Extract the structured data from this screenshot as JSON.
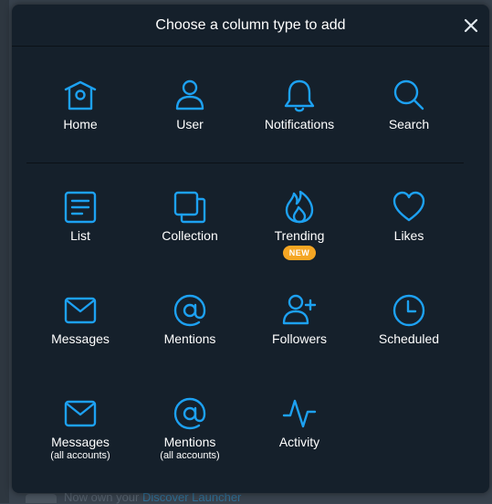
{
  "background": {
    "text_prefix": "Now own your",
    "text_link": "Discover Launcher",
    "colors": {
      "modal_bg": "#15202b",
      "accent": "#1da1f2",
      "badge": "#f5a623"
    }
  },
  "modal": {
    "title": "Choose a column type to add",
    "close_label": "×"
  },
  "columns": [
    {
      "id": "home",
      "label": "Home",
      "icon": "home-icon"
    },
    {
      "id": "user",
      "label": "User",
      "icon": "user-icon"
    },
    {
      "id": "notifications",
      "label": "Notifications",
      "icon": "bell-icon"
    },
    {
      "id": "search",
      "label": "Search",
      "icon": "search-icon"
    },
    {
      "id": "list",
      "label": "List",
      "icon": "list-icon"
    },
    {
      "id": "collection",
      "label": "Collection",
      "icon": "collection-icon"
    },
    {
      "id": "trending",
      "label": "Trending",
      "icon": "flame-icon",
      "badge": "NEW"
    },
    {
      "id": "likes",
      "label": "Likes",
      "icon": "heart-icon"
    },
    {
      "id": "messages",
      "label": "Messages",
      "icon": "envelope-icon"
    },
    {
      "id": "mentions",
      "label": "Mentions",
      "icon": "at-icon"
    },
    {
      "id": "followers",
      "label": "Followers",
      "icon": "user-plus-icon"
    },
    {
      "id": "scheduled",
      "label": "Scheduled",
      "icon": "clock-icon"
    },
    {
      "id": "messages_all",
      "label": "Messages",
      "sublabel": "(all accounts)",
      "icon": "envelope-icon"
    },
    {
      "id": "mentions_all",
      "label": "Mentions",
      "sublabel": "(all accounts)",
      "icon": "at-icon"
    },
    {
      "id": "activity",
      "label": "Activity",
      "icon": "activity-icon"
    }
  ]
}
